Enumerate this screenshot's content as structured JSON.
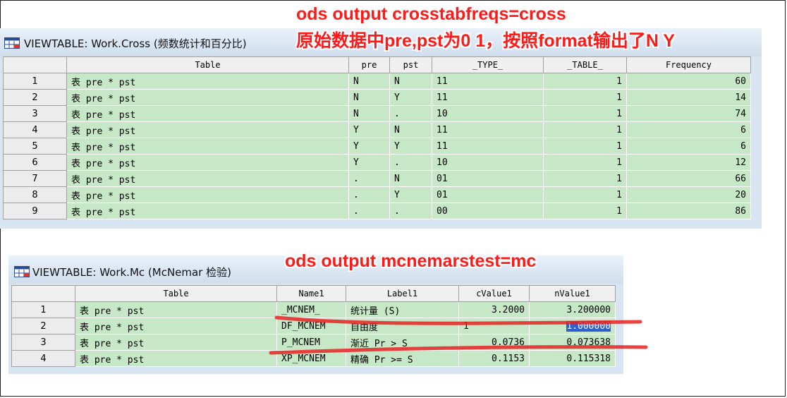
{
  "annotations": {
    "top_line1": "ods output crosstabfreqs=cross",
    "top_line2": "原始数据中pre,pst为0 1，按照format输出了N Y",
    "bottom": "ods output mcnemarstest=mc"
  },
  "window1": {
    "title": "VIEWTABLE: Work.Cross (频数统计和百分比)",
    "columns": [
      "Table",
      "pre",
      "pst",
      "_TYPE_",
      "_TABLE_",
      "Frequency"
    ],
    "rows": [
      {
        "n": "1",
        "table": "表 pre * pst",
        "pre": "N",
        "pst": "N",
        "type": "11",
        "table_id": "1",
        "freq": "60"
      },
      {
        "n": "2",
        "table": "表 pre * pst",
        "pre": "N",
        "pst": "Y",
        "type": "11",
        "table_id": "1",
        "freq": "14"
      },
      {
        "n": "3",
        "table": "表 pre * pst",
        "pre": "N",
        "pst": ".",
        "type": "10",
        "table_id": "1",
        "freq": "74"
      },
      {
        "n": "4",
        "table": "表 pre * pst",
        "pre": "Y",
        "pst": "N",
        "type": "11",
        "table_id": "1",
        "freq": "6"
      },
      {
        "n": "5",
        "table": "表 pre * pst",
        "pre": "Y",
        "pst": "Y",
        "type": "11",
        "table_id": "1",
        "freq": "6"
      },
      {
        "n": "6",
        "table": "表 pre * pst",
        "pre": "Y",
        "pst": ".",
        "type": "10",
        "table_id": "1",
        "freq": "12"
      },
      {
        "n": "7",
        "table": "表 pre * pst",
        "pre": ".",
        "pst": "N",
        "type": "01",
        "table_id": "1",
        "freq": "66"
      },
      {
        "n": "8",
        "table": "表 pre * pst",
        "pre": ".",
        "pst": "Y",
        "type": "01",
        "table_id": "1",
        "freq": "20"
      },
      {
        "n": "9",
        "table": "表 pre * pst",
        "pre": ".",
        "pst": ".",
        "type": "00",
        "table_id": "1",
        "freq": "86"
      }
    ]
  },
  "window2": {
    "title": "VIEWTABLE: Work.Mc (McNemar 检验)",
    "columns": [
      "Table",
      "Name1",
      "Label1",
      "cValue1",
      "nValue1"
    ],
    "rows": [
      {
        "n": "1",
        "table": "表 pre * pst",
        "name1": "_MCNEM_",
        "label1": "统计量 (S)",
        "cvalue": "3.2000",
        "nvalue": "3.200000"
      },
      {
        "n": "2",
        "table": "表 pre * pst",
        "name1": "DF_MCNEM",
        "label1": "自由度",
        "cvalue": "1",
        "nvalue": "1.000000"
      },
      {
        "n": "3",
        "table": "表 pre * pst",
        "name1": "P_MCNEM",
        "label1": "渐近 Pr >  S",
        "cvalue": "0.0736",
        "nvalue": "0.073638"
      },
      {
        "n": "4",
        "table": "表 pre * pst",
        "name1": "XP_MCNEM",
        "label1": "精确 Pr >= S",
        "cvalue": "0.1153",
        "nvalue": "0.115318"
      }
    ]
  },
  "colors": {
    "cell_green": "#c7e8c6",
    "annotation_red": "#ff1a1a",
    "selection_blue": "#2f5fd0"
  },
  "icons": {
    "window_icon": "table-window-icon"
  }
}
